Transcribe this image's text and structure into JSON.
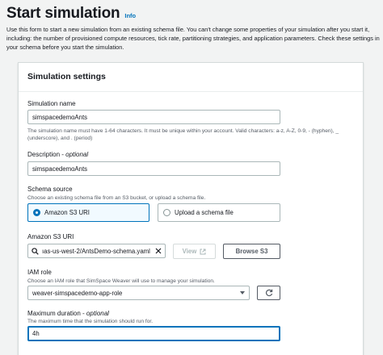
{
  "page": {
    "title": "Start simulation",
    "info": "Info",
    "description": "Use this form to start a new simulation from an existing schema file. You can't change some properties of your simulation after you start it, including: the number of provisioned compute resources, tick rate, partitioning strategies, and application parameters. Check these settings in your schema before you start the simulation."
  },
  "panel": {
    "title": "Simulation settings",
    "name": {
      "label": "Simulation name",
      "value": "simspacedemoAnts",
      "hint": "The simulation name must have 1-64 characters. It must be unique within your account. Valid characters: a-z, A-Z, 0-9, - (hyphen), _ (underscore), and . (period)"
    },
    "description": {
      "label": "Description",
      "optional": "optional",
      "value": "simspacedemoAnts"
    },
    "schema_source": {
      "label": "Schema source",
      "hint": "Choose an existing schema file from an S3 bucket, or upload a schema file.",
      "options": [
        "Amazon S3 URI",
        "Upload a schema file"
      ],
      "selected": "Amazon S3 URI"
    },
    "s3_uri": {
      "label": "Amazon S3 URI",
      "value": "ıas-us-west-2/AntsDemo-schema.yaml",
      "view_label": "View",
      "browse_label": "Browse S3"
    },
    "iam_role": {
      "label": "IAM role",
      "hint": "Choose an IAM role that SimSpace Weaver will use to manage your simulation.",
      "value": "weaver-simspacedemo-app-role"
    },
    "max_duration": {
      "label": "Maximum duration",
      "optional": "optional",
      "hint": "The maximum time that the simulation should run for.",
      "value": "4h"
    }
  },
  "colors": {
    "accent": "#0073bb",
    "background": "#f2f3f3",
    "border": "#aab7b8"
  }
}
